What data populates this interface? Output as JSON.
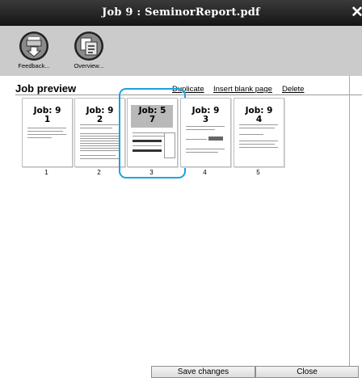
{
  "window": {
    "title": "Job 9 : SeminorReport.pdf",
    "close_glyph": "✕"
  },
  "toolbar": {
    "items": [
      {
        "label": "Feedback...",
        "icon": "feedback-icon"
      },
      {
        "label": "Overview...",
        "icon": "overview-icon"
      }
    ]
  },
  "preview": {
    "title": "Job preview",
    "actions": {
      "duplicate": "Duplicate",
      "insert_blank": "Insert blank page",
      "delete": "Delete"
    },
    "pages": [
      {
        "number": "1",
        "label_line1": "Job: 9",
        "label_line2": "1"
      },
      {
        "number": "2",
        "label_line1": "Job: 9",
        "label_line2": "2"
      },
      {
        "number": "3",
        "label_line1": "Job: 5",
        "label_line2": "7",
        "selected": true
      },
      {
        "number": "4",
        "label_line1": "Job: 9",
        "label_line2": "3"
      },
      {
        "number": "5",
        "label_line1": "Job: 9",
        "label_line2": "4"
      }
    ]
  },
  "footer": {
    "save": "Save changes",
    "close": "Close"
  },
  "colors": {
    "title_bar": "#1e1e1e",
    "toolbar": "#cbcbcb",
    "selection": "#1aa3e0"
  }
}
